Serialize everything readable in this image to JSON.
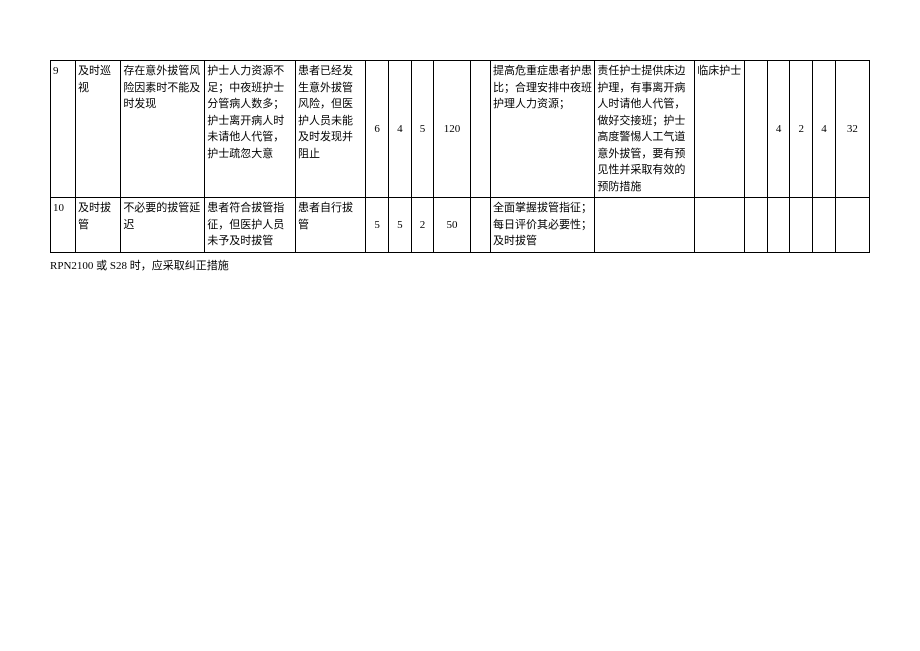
{
  "rows": [
    {
      "idx": "9",
      "label": "及时巡视",
      "colA": "存在意外拔管风险因素时不能及时发现",
      "colB": "护士人力资源不足；中夜班护士分管病人数多；护士离开病人时未请他人代管，护士疏忽大意",
      "colC": "患者已经发生意外拔管风险，但医护人员未能及时发现并阻止",
      "n1": "6",
      "n2": "4",
      "n3": "5",
      "rpn": "120",
      "blank": "",
      "colD": "提高危重症患者护患比；合理安排中夜班护理人力资源；",
      "colE": "责任护士提供床边护理，有事离开病人时请他人代管，做好交接班；护士高度警惕人工气道意外拔管，要有预见性并采取有效的预防措施",
      "colF": "临床护士",
      "m1": "",
      "m2": "4",
      "m3": "2",
      "m4": "4",
      "rpn2": "32"
    },
    {
      "idx": "10",
      "label": "及时拔管",
      "colA": "不必要的拔管延迟",
      "colB": "患者符合拔管指征，但医护人员未予及时拔管",
      "colC": "患者自行拔管",
      "n1": "5",
      "n2": "5",
      "n3": "2",
      "rpn": "50",
      "blank": "",
      "colD": "全面掌握拔管指征；每日评价其必要性；及时拔管",
      "colE": "",
      "colF": "",
      "m1": "",
      "m2": "",
      "m3": "",
      "m4": "",
      "rpn2": ""
    }
  ],
  "footnote": "RPN2100 或 S28 时，应采取纠正措施"
}
